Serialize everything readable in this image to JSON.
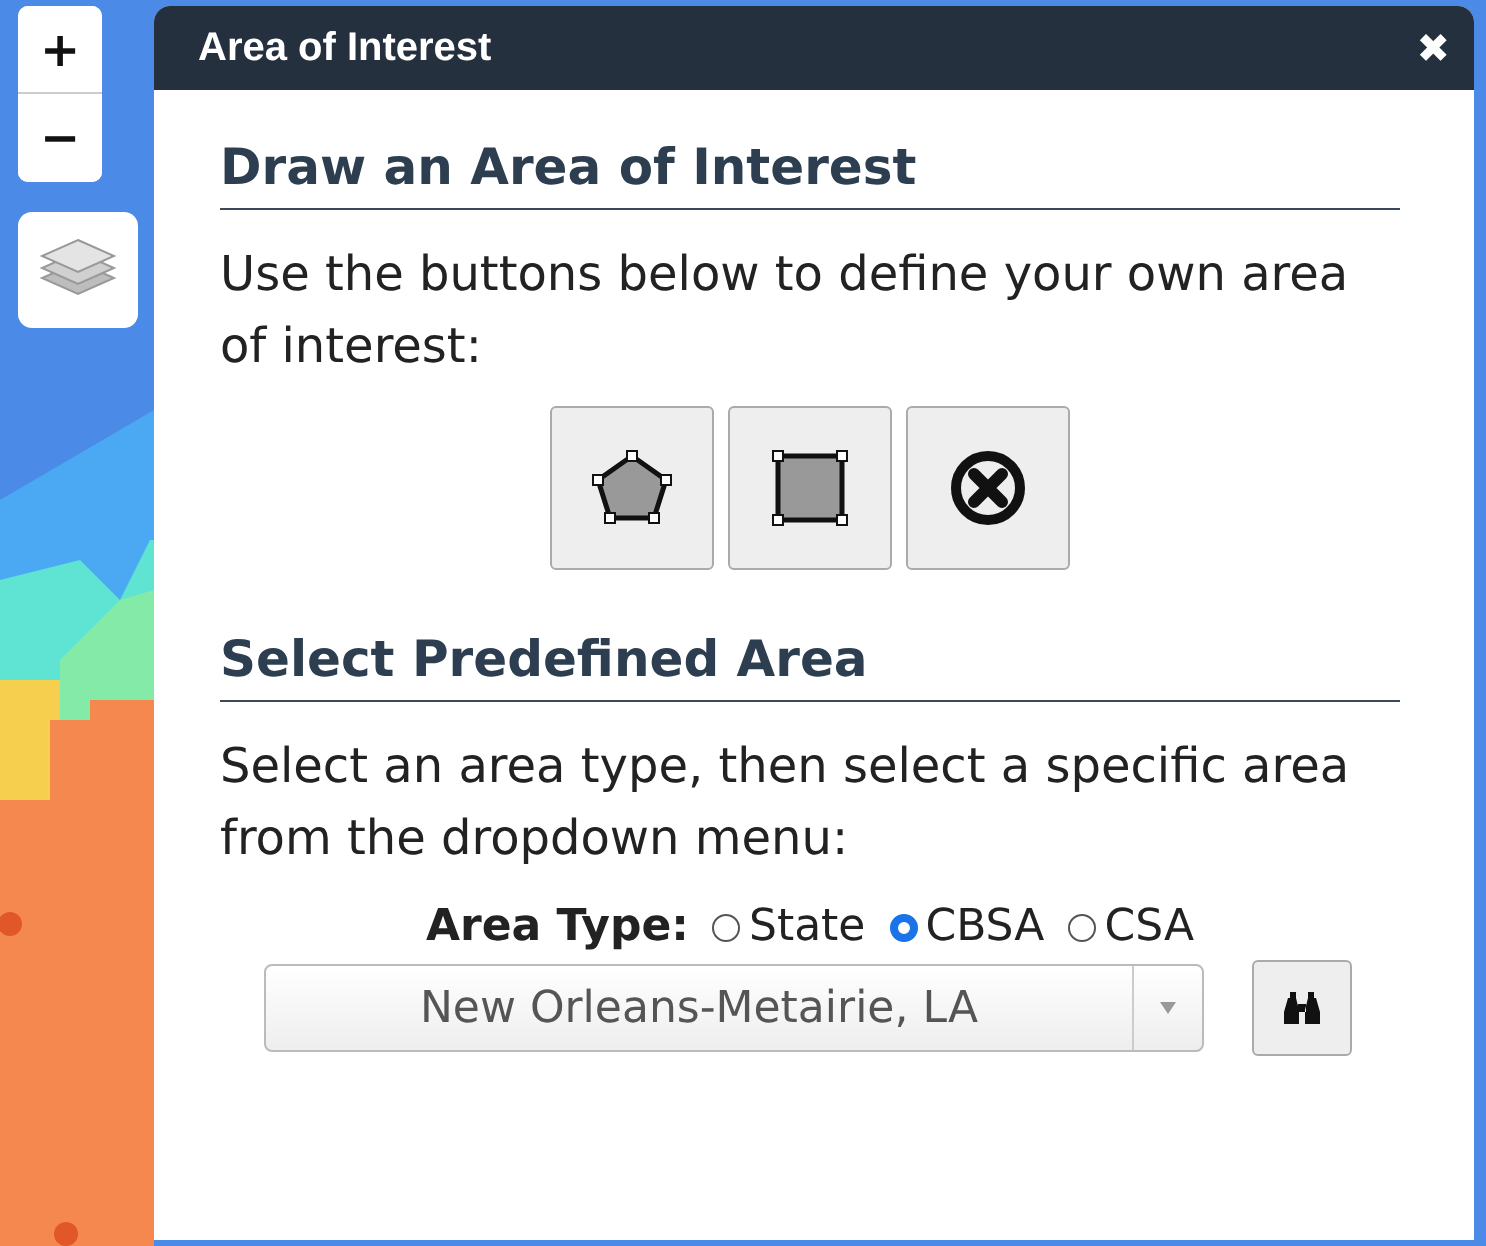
{
  "map_controls": {
    "zoom_in": "+",
    "zoom_out": "−"
  },
  "panel": {
    "title": "Area of Interest",
    "close": "✖",
    "draw": {
      "heading": "Draw an Area of Interest",
      "description": "Use the buttons below to define your own area of interest:"
    },
    "predefined": {
      "heading": "Select Predefined Area",
      "description": "Select an area type, then select a specific area from the dropdown menu:",
      "area_type_label": "Area Type:",
      "options": [
        {
          "label": "State",
          "selected": false
        },
        {
          "label": "CBSA",
          "selected": true
        },
        {
          "label": "CSA",
          "selected": false
        }
      ],
      "dropdown": {
        "value": "New Orleans-Metairie, LA"
      }
    }
  }
}
